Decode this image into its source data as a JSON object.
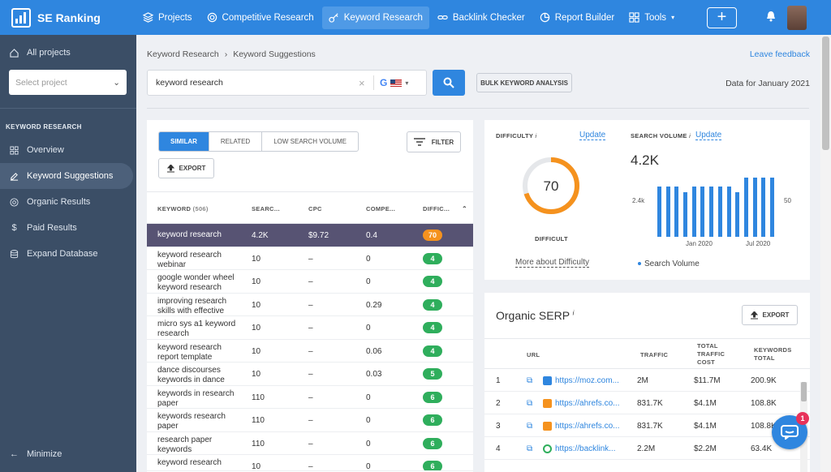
{
  "topbar": {
    "brand": "SE Ranking",
    "nav": [
      {
        "label": "Projects",
        "icon": "layers-icon"
      },
      {
        "label": "Competitive Research",
        "icon": "target-icon"
      },
      {
        "label": "Keyword Research",
        "icon": "key-icon",
        "active": true
      },
      {
        "label": "Backlink Checker",
        "icon": "link-icon"
      },
      {
        "label": "Report Builder",
        "icon": "pie-icon"
      },
      {
        "label": "Tools",
        "icon": "grid-icon"
      }
    ],
    "add_label": "+"
  },
  "sidebar": {
    "all_projects": "All projects",
    "select_placeholder": "Select project",
    "section_heading": "KEYWORD RESEARCH",
    "items": [
      {
        "label": "Overview"
      },
      {
        "label": "Keyword Suggestions",
        "active": true
      },
      {
        "label": "Organic Results"
      },
      {
        "label": "Paid Results"
      },
      {
        "label": "Expand Database"
      }
    ],
    "minimize": "Minimize"
  },
  "main": {
    "breadcrumb": [
      "Keyword Research",
      "Keyword Suggestions"
    ],
    "feedback": "Leave feedback",
    "search_value": "keyword research",
    "bulk_label": "BULK KEYWORD ANALYSIS",
    "data_for": "Data for January 2021"
  },
  "keywords": {
    "tabs": [
      "SIMILAR",
      "RELATED",
      "LOW SEARCH VOLUME"
    ],
    "filter_label": "FILTER",
    "export_label": "EXPORT",
    "headers": {
      "keyword": "KEYWORD",
      "count": "(506)",
      "search": "SEARC...",
      "cpc": "CPC",
      "comp": "COMPE...",
      "diff": "DIFFIC..."
    },
    "rows": [
      {
        "keyword": "keyword research",
        "search": "4.2K",
        "cpc": "$9.72",
        "comp": "0.4",
        "diff": "70"
      },
      {
        "keyword": "keyword research webinar",
        "search": "10",
        "cpc": "–",
        "comp": "0",
        "diff": "4"
      },
      {
        "keyword": "google wonder wheel keyword research",
        "search": "10",
        "cpc": "–",
        "comp": "0",
        "diff": "4"
      },
      {
        "keyword": "improving research skills with effective",
        "search": "10",
        "cpc": "–",
        "comp": "0.29",
        "diff": "4"
      },
      {
        "keyword": "micro sys a1 keyword research",
        "search": "10",
        "cpc": "–",
        "comp": "0",
        "diff": "4"
      },
      {
        "keyword": "keyword research report template",
        "search": "10",
        "cpc": "–",
        "comp": "0.06",
        "diff": "4"
      },
      {
        "keyword": "dance discourses keywords in dance",
        "search": "10",
        "cpc": "–",
        "comp": "0.03",
        "diff": "5"
      },
      {
        "keyword": "keywords in research paper",
        "search": "110",
        "cpc": "–",
        "comp": "0",
        "diff": "6"
      },
      {
        "keyword": "keywords research paper",
        "search": "110",
        "cpc": "–",
        "comp": "0",
        "diff": "6"
      },
      {
        "keyword": "research paper keywords",
        "search": "110",
        "cpc": "–",
        "comp": "0",
        "diff": "6"
      },
      {
        "keyword": "keyword research",
        "search": "10",
        "cpc": "–",
        "comp": "0",
        "diff": "6"
      }
    ]
  },
  "difficulty": {
    "label": "DIFFICULTY",
    "update": "Update",
    "value": "70",
    "level": 0.7,
    "status": "DIFFICULT",
    "more": "More about Difficulty",
    "gauge_color": "#f5921e"
  },
  "volume": {
    "label": "SEARCH VOLUME",
    "update": "Update",
    "value": "4.2K",
    "y_left": "2.4k",
    "y_right": "50",
    "x_labels": [
      "Jan 2020",
      "Jul 2020"
    ],
    "legend": "Search Volume"
  },
  "chart_data": {
    "type": "bar",
    "title": "",
    "series": [
      {
        "name": "Search Volume",
        "values": [
          3.6,
          3.6,
          3.6,
          3.2,
          3.6,
          3.6,
          3.6,
          3.6,
          3.6,
          3.2,
          4.2,
          4.2,
          4.2,
          4.2
        ]
      }
    ],
    "ylim": [
      0,
      4.4
    ],
    "color": "#2f86df"
  },
  "serp": {
    "title": "Organic SERP",
    "export_label": "EXPORT",
    "headers": {
      "url": "URL",
      "traffic": "TRAFFIC",
      "cost": [
        "TOTAL",
        "TRAFFIC",
        "COST"
      ],
      "kw": [
        "KEYWORDS",
        "TOTAL"
      ]
    },
    "rows": [
      {
        "n": "1",
        "url": "https://moz.com...",
        "favicon": "#2f86df",
        "traffic": "2M",
        "cost": "$11.7M",
        "kw": "200.9K"
      },
      {
        "n": "2",
        "url": "https://ahrefs.co...",
        "favicon": "#f5921e",
        "traffic": "831.7K",
        "cost": "$4.1M",
        "kw": "108.8K"
      },
      {
        "n": "3",
        "url": "https://ahrefs.co...",
        "favicon": "#f5921e",
        "traffic": "831.7K",
        "cost": "$4.1M",
        "kw": "108.8K"
      },
      {
        "n": "4",
        "url": "https://backlink...",
        "favicon": "#2fae5c",
        "traffic": "2.2M",
        "cost": "$2.2M",
        "kw": "63.4K"
      }
    ]
  },
  "chat": {
    "badge": "1"
  }
}
